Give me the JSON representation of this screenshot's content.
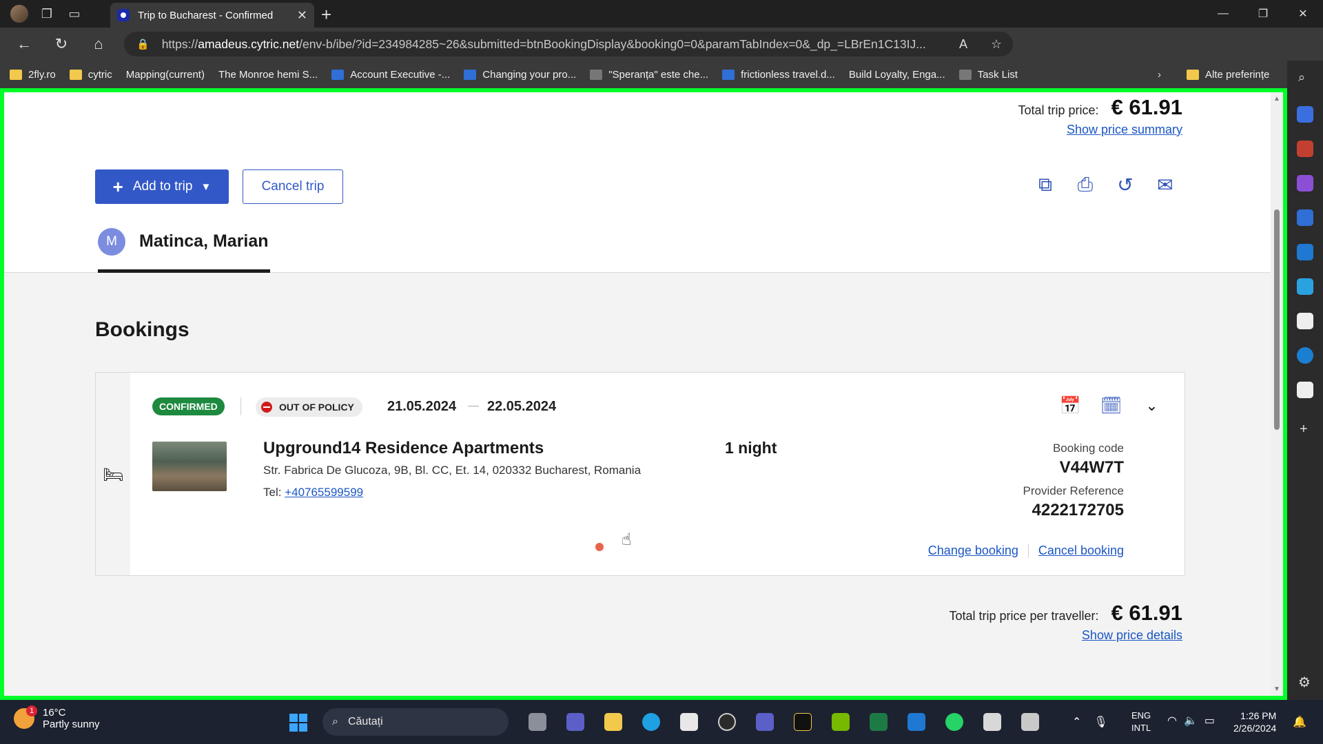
{
  "browser": {
    "tab_title": "Trip to Bucharest - Confirmed",
    "url_domain": "amadeus.cytric.net",
    "url_prefix": "https://",
    "url_path": "/env-b/ibe/?id=234984285~26&submitted=btnBookingDisplay&booking0=0&paramTabIndex=0&_dp_=LBrEn1C13IJ..."
  },
  "bookmarks": [
    {
      "label": "2fly.ro",
      "icon": "folder-icon"
    },
    {
      "label": "cytric",
      "icon": "folder-icon"
    },
    {
      "label": "Mapping(current)",
      "icon": "page-icon"
    },
    {
      "label": "The Monroe hemi S...",
      "icon": "building-icon"
    },
    {
      "label": "Account Executive -...",
      "icon": "link-icon"
    },
    {
      "label": "Changing your pro...",
      "icon": "b-icon"
    },
    {
      "label": "\"Speranța\" este che...",
      "icon": "bird-icon"
    },
    {
      "label": "frictionless travel.d...",
      "icon": "doc-icon"
    },
    {
      "label": "Build Loyalty, Enga...",
      "icon": "chart-icon"
    },
    {
      "label": "Task List",
      "icon": "tool-icon"
    }
  ],
  "bookmarks_other": "Alte preferințe",
  "header": {
    "total_label": "Total trip price:",
    "total_amount": "€ 61.91",
    "price_summary_link": "Show price summary"
  },
  "actions": {
    "add_to_trip": "Add to trip",
    "cancel_trip": "Cancel trip"
  },
  "traveller": {
    "initial": "M",
    "name": "Matinca, Marian"
  },
  "bookings": {
    "title": "Bookings",
    "items": [
      {
        "status": "CONFIRMED",
        "policy": "OUT OF POLICY",
        "date_from": "21.05.2024",
        "date_to": "22.05.2024",
        "hotel_name": "Upground14 Residence Apartments",
        "address": "Str. Fabrica De Glucoza, 9B, Bl. CC, Et. 14, 020332 Bucharest, Romania",
        "tel_label": "Tel: ",
        "tel": "+40765599599",
        "nights": "1 night",
        "booking_code_label": "Booking code",
        "booking_code": "V44W7T",
        "provider_ref_label": "Provider Reference",
        "provider_ref": "4222172705",
        "change_link": "Change booking",
        "cancel_link": "Cancel booking"
      }
    ]
  },
  "footer_total": {
    "label": "Total trip price per traveller:",
    "amount": "€ 61.91",
    "details_link": "Show price details"
  },
  "taskbar": {
    "weather_temp": "16°C",
    "weather_desc": "Partly sunny",
    "weather_badge": "1",
    "search_placeholder": "Căutați",
    "lang_top": "ENG",
    "lang_bottom": "INTL",
    "time": "1:26 PM",
    "date": "2/26/2024"
  },
  "colors": {
    "accent": "#3258c8",
    "confirmed": "#1d8a3f",
    "out_of_policy": "#d01b1b",
    "highlight_border": "#00ff2a"
  }
}
